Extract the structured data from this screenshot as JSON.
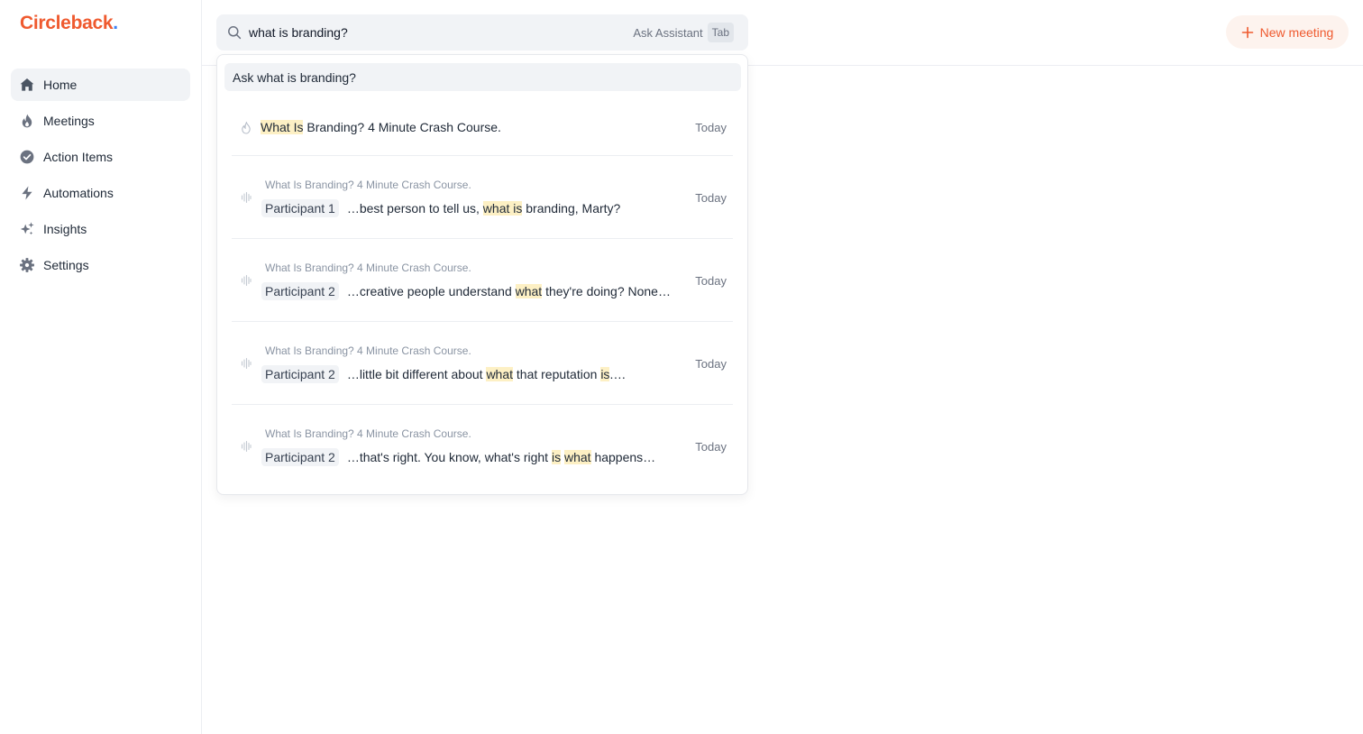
{
  "app": {
    "logo": "Circleback",
    "logo_dot": "."
  },
  "sidebar": {
    "items": [
      {
        "label": "Home",
        "icon": "home-icon",
        "active": true
      },
      {
        "label": "Meetings",
        "icon": "flame-icon"
      },
      {
        "label": "Action Items",
        "icon": "check-circle-icon"
      },
      {
        "label": "Automations",
        "icon": "bolt-icon"
      },
      {
        "label": "Insights",
        "icon": "sparkles-icon"
      },
      {
        "label": "Settings",
        "icon": "gear-icon"
      }
    ]
  },
  "search": {
    "value": "what is branding?",
    "ask_label": "Ask Assistant",
    "key_hint": "Tab"
  },
  "header": {
    "new_meeting_label": "New meeting"
  },
  "dropdown": {
    "ask_row": "Ask what is branding?",
    "results": [
      {
        "type": "meeting",
        "icon": "flame-icon",
        "title_parts": [
          {
            "t": "What Is",
            "hl": true
          },
          {
            "t": " Branding? 4 Minute Crash Course.",
            "hl": false
          }
        ],
        "date": "Today"
      },
      {
        "type": "transcript",
        "icon": "waveform-icon",
        "meeting": "What Is Branding? 4 Minute Crash Course.",
        "speaker": "Participant 1",
        "snippet_parts": [
          {
            "t": "…best person to tell us, ",
            "hl": false
          },
          {
            "t": "what is",
            "hl": true
          },
          {
            "t": " branding, Marty?",
            "hl": false
          }
        ],
        "date": "Today"
      },
      {
        "type": "transcript",
        "icon": "waveform-icon",
        "meeting": "What Is Branding? 4 Minute Crash Course.",
        "speaker": "Participant 2",
        "snippet_parts": [
          {
            "t": "…creative people understand ",
            "hl": false
          },
          {
            "t": "what",
            "hl": true
          },
          {
            "t": " they're doing? None…",
            "hl": false
          }
        ],
        "date": "Today"
      },
      {
        "type": "transcript",
        "icon": "waveform-icon",
        "meeting": "What Is Branding? 4 Minute Crash Course.",
        "speaker": "Participant 2",
        "snippet_parts": [
          {
            "t": "…little bit different about ",
            "hl": false
          },
          {
            "t": "what",
            "hl": true
          },
          {
            "t": " that reputation ",
            "hl": false
          },
          {
            "t": "is",
            "hl": true
          },
          {
            "t": ".…",
            "hl": false
          }
        ],
        "date": "Today"
      },
      {
        "type": "transcript",
        "icon": "waveform-icon",
        "meeting": "What Is Branding? 4 Minute Crash Course.",
        "speaker": "Participant 2",
        "snippet_parts": [
          {
            "t": "…that's right. You know, what's right ",
            "hl": false
          },
          {
            "t": "is",
            "hl": true
          },
          {
            "t": " ",
            "hl": false
          },
          {
            "t": "what",
            "hl": true
          },
          {
            "t": " happens…",
            "hl": false
          }
        ],
        "date": "Today"
      }
    ]
  },
  "colors": {
    "brand": "#ef5a2f",
    "logo_dot": "#3b82f6",
    "highlight": "#fdf0c4",
    "nav_active_bg": "#f1f3f6",
    "button_bg": "#fdf3ee"
  }
}
